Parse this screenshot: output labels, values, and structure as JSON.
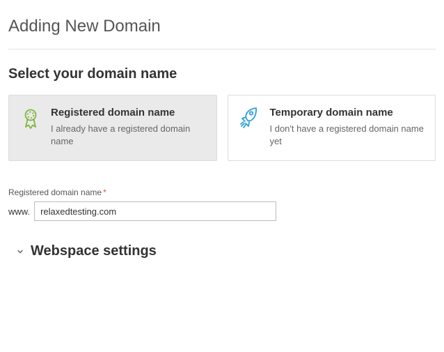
{
  "page_title": "Adding New Domain",
  "section_title": "Select your domain name",
  "cards": {
    "registered": {
      "title": "Registered domain name",
      "desc": "I already have a registered domain name"
    },
    "temporary": {
      "title": "Temporary domain name",
      "desc": "I don't have a registered domain name yet"
    }
  },
  "field": {
    "label": "Registered domain name",
    "required_mark": "*",
    "prefix": "www.",
    "value": "relaxedtesting.com"
  },
  "collapsible": {
    "webspace_title": "Webspace settings"
  },
  "colors": {
    "badge_icon": "#80b63d",
    "rocket_icon": "#2a9ed6"
  }
}
